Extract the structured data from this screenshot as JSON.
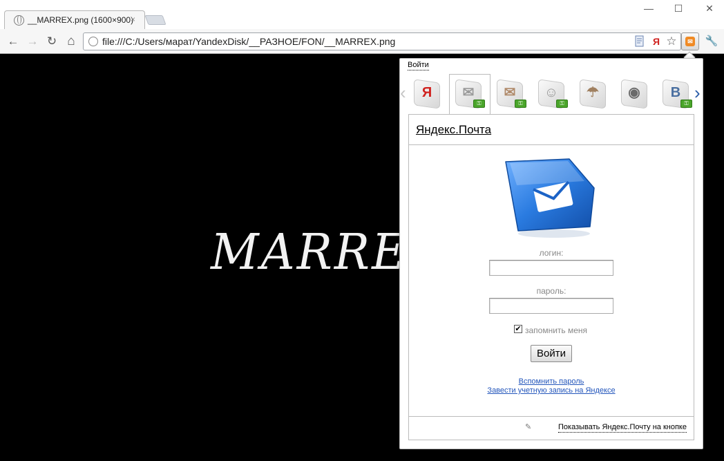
{
  "browser": {
    "tab_title": "__MARREX.png (1600×900)",
    "tab_close": "×",
    "url": "file:///C:/Users/марат/YandexDisk/__РАЗНОЕ/FON/__MARREX.png",
    "window_controls": {
      "minimize": "—",
      "maximize": "☐",
      "close": "✕"
    },
    "nav": {
      "back": "←",
      "forward": "→",
      "reload": "↻",
      "home": "⌂"
    },
    "omni_icons": [
      "page-icon",
      "yandex-icon",
      "star-icon"
    ],
    "yandex_letter": "Я"
  },
  "page": {
    "image_text": "MARREX"
  },
  "popup": {
    "login_link": "Войти",
    "services": [
      {
        "icon": "yandex-icon",
        "glyph": "Я",
        "color": "#d0221f",
        "key": false,
        "active": false
      },
      {
        "icon": "mail-icon",
        "glyph": "✉",
        "color": "#9a9a9a",
        "key": true,
        "active": true
      },
      {
        "icon": "postcard-icon",
        "glyph": "✉",
        "color": "#b08a6a",
        "key": true,
        "active": false
      },
      {
        "icon": "person-icon",
        "glyph": "☺",
        "color": "#9a9a9a",
        "key": true,
        "active": false
      },
      {
        "icon": "umbrella-icon",
        "glyph": "☂",
        "color": "#a08060",
        "key": false,
        "active": false
      },
      {
        "icon": "sphere-icon",
        "glyph": "◉",
        "color": "#6a6a6a",
        "key": false,
        "active": false
      },
      {
        "icon": "vk-icon",
        "glyph": "B",
        "color": "#4a6fa0",
        "key": true,
        "active": false
      }
    ],
    "panel": {
      "title": "Яндекс.Почта",
      "login_label": "логин:",
      "login_value": "",
      "password_label": "пароль:",
      "password_value": "",
      "remember_label": "запомнить меня",
      "remember_checked": true,
      "submit": "Войти",
      "forgot_link": "Вспомнить пароль",
      "register_link": "Завести учетную запись на Яндексе",
      "footer_link": "Показывать Яндекс.Почту на кнопке"
    },
    "colors": {
      "link": "#2255bb",
      "active_arrow": "#2a5ca8",
      "key_badge": "#4aa52a"
    }
  }
}
